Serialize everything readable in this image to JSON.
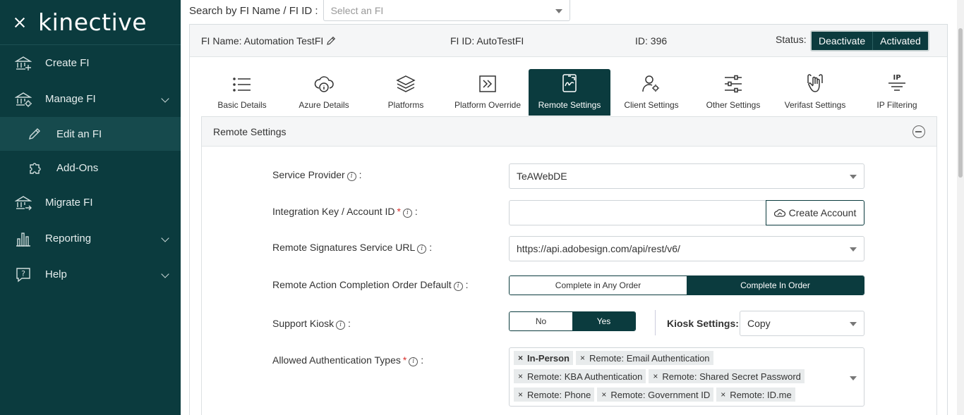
{
  "sidebar": {
    "logo": "kinective",
    "items": [
      {
        "label": "Create FI",
        "icon": "bank-plus-icon"
      },
      {
        "label": "Manage FI",
        "icon": "bank-gear-icon"
      },
      {
        "label": "Edit an FI",
        "icon": "pencil-icon"
      },
      {
        "label": "Add-Ons",
        "icon": "puzzle-icon"
      },
      {
        "label": "Migrate FI",
        "icon": "bank-arrow-icon"
      },
      {
        "label": "Reporting",
        "icon": "bar-chart-icon"
      },
      {
        "label": "Help",
        "icon": "help-bubble-icon"
      }
    ]
  },
  "search": {
    "label": "Search by FI Name / FI ID :",
    "placeholder": "Select an FI"
  },
  "header": {
    "fi_name": "FI Name: Automation TestFI",
    "fi_id": "FI ID: AutoTestFI",
    "id": "ID: 396",
    "status_label": "Status:",
    "deactivate": "Deactivate",
    "activated": "Activated"
  },
  "tabs": [
    {
      "label": "Basic Details",
      "icon": "list-icon"
    },
    {
      "label": "Azure Details",
      "icon": "cloud-info-icon"
    },
    {
      "label": "Platforms",
      "icon": "layers-icon"
    },
    {
      "label": "Platform Override",
      "icon": "override-arrow-icon"
    },
    {
      "label": "Remote Settings",
      "icon": "remote-sign-icon",
      "active": true
    },
    {
      "label": "Client Settings",
      "icon": "user-gear-icon"
    },
    {
      "label": "Other Settings",
      "icon": "sliders-icon"
    },
    {
      "label": "Verifast Settings",
      "icon": "hand-touch-icon"
    },
    {
      "label": "IP Filtering",
      "icon": "ip-filter-icon"
    }
  ],
  "section": {
    "title": "Remote Settings",
    "service_provider": {
      "label": "Service Provider",
      "value": "TeAWebDE"
    },
    "integration_key": {
      "label": "Integration Key / Account ID",
      "value": "",
      "button": "Create Account"
    },
    "remote_url": {
      "label": "Remote Signatures Service URL",
      "value": "https://api.adobesign.com/api/rest/v6/"
    },
    "completion_order": {
      "label": "Remote Action Completion Order Default",
      "option_a": "Complete in Any Order",
      "option_b": "Complete In Order"
    },
    "support_kiosk": {
      "label": "Support Kiosk",
      "no": "No",
      "yes": "Yes"
    },
    "kiosk_settings": {
      "label": "Kiosk Settings:",
      "value": "Copy"
    },
    "auth_types": {
      "label": "Allowed Authentication Types",
      "tags": [
        "In-Person",
        "Remote: Email Authentication",
        "Remote: KBA Authentication",
        "Remote: Shared Secret Password",
        "Remote: Phone",
        "Remote: Government ID",
        "Remote: ID.me"
      ]
    }
  },
  "colors": {
    "primary": "#0b3b3e",
    "required": "#d9302c"
  }
}
